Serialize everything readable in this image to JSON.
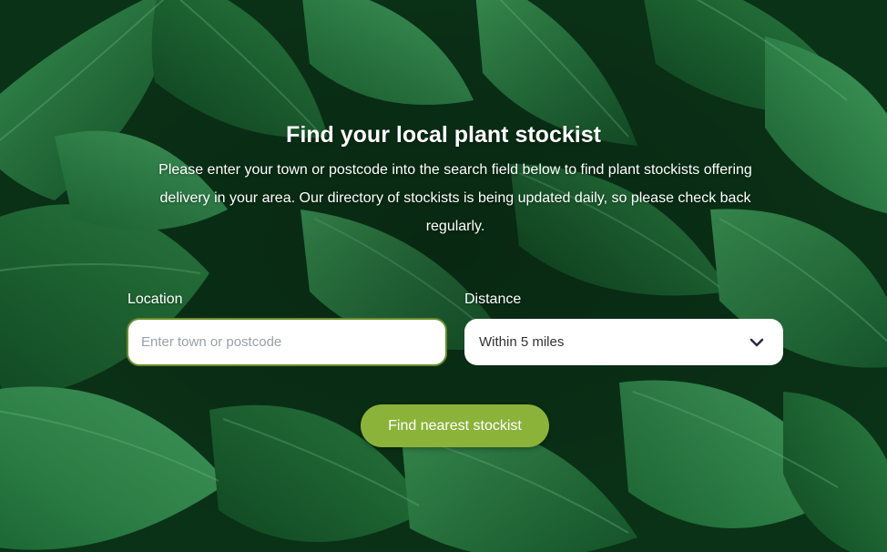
{
  "hero": {
    "title": "Find your local plant stockist",
    "intro": "Please enter your town or postcode into the search field below to find plant stockists offering delivery in your area. Our directory of stockists is being updated daily, so please check back regularly."
  },
  "form": {
    "location_label": "Location",
    "location_placeholder": "Enter town or postcode",
    "location_value": "",
    "distance_label": "Distance",
    "distance_selected": "Within 5 miles",
    "submit_label": "Find nearest stockist"
  },
  "icons": {
    "dropdown": "chevron-down-icon"
  },
  "colors": {
    "button": "#8bb33a",
    "input_border": "#6a8d2b",
    "chevron": "#2b2a4a",
    "background_dark": "#0d3d1c",
    "leaf_light": "#2e8a47"
  }
}
